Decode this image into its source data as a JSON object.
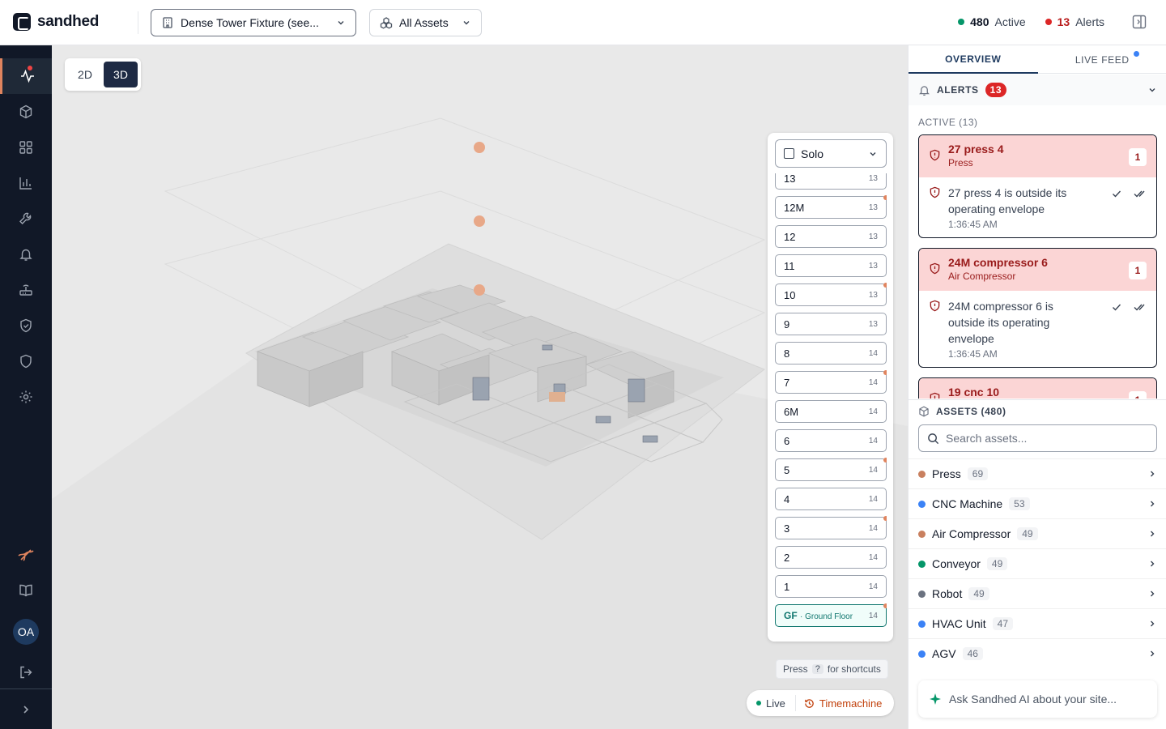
{
  "app": {
    "name": "sandhed"
  },
  "header": {
    "site_selector": "Dense Tower Fixture (see...",
    "asset_filter": "All Assets",
    "active_count": "480",
    "active_label": "Active",
    "alerts_count": "13",
    "alerts_label": "Alerts"
  },
  "sidebar": {
    "items": [
      {
        "name": "activity",
        "icon": "activity-icon",
        "active": true
      },
      {
        "name": "assets",
        "icon": "cube-icon"
      },
      {
        "name": "dashboard",
        "icon": "grid-icon"
      },
      {
        "name": "analytics",
        "icon": "bar-chart-icon"
      },
      {
        "name": "maintenance",
        "icon": "wrench-icon"
      },
      {
        "name": "alerts",
        "icon": "bell-icon"
      },
      {
        "name": "gateways",
        "icon": "router-icon"
      },
      {
        "name": "compliance",
        "icon": "shield-check-icon"
      },
      {
        "name": "security",
        "icon": "shield-icon"
      },
      {
        "name": "settings",
        "icon": "gear-icon"
      }
    ],
    "avatar_initials": "OA"
  },
  "viewport": {
    "view_modes": [
      "2D",
      "3D"
    ],
    "selected_view": "3D",
    "solo_label": "Solo",
    "floors": [
      {
        "name": "13",
        "count": "13",
        "alert": false
      },
      {
        "name": "12M",
        "count": "13",
        "alert": true
      },
      {
        "name": "12",
        "count": "13",
        "alert": false
      },
      {
        "name": "11",
        "count": "13",
        "alert": false
      },
      {
        "name": "10",
        "count": "13",
        "alert": true
      },
      {
        "name": "9",
        "count": "13",
        "alert": false
      },
      {
        "name": "8",
        "count": "14",
        "alert": false
      },
      {
        "name": "7",
        "count": "14",
        "alert": true
      },
      {
        "name": "6M",
        "count": "14",
        "alert": false
      },
      {
        "name": "6",
        "count": "14",
        "alert": false
      },
      {
        "name": "5",
        "count": "14",
        "alert": true
      },
      {
        "name": "4",
        "count": "14",
        "alert": false
      },
      {
        "name": "3",
        "count": "14",
        "alert": true
      },
      {
        "name": "2",
        "count": "14",
        "alert": false
      },
      {
        "name": "1",
        "count": "14",
        "alert": false
      }
    ],
    "ground_floor": {
      "code": "GF",
      "name": "· Ground Floor",
      "count": "14",
      "alert": true
    },
    "shortcuts": {
      "pre": "Press",
      "key": "?",
      "post": "for shortcuts"
    },
    "live_label": "Live",
    "timemachine_label": "Timemachine"
  },
  "right_panel": {
    "tabs": [
      "OVERVIEW",
      "LIVE FEED"
    ],
    "alerts_title": "ALERTS",
    "alerts_badge": "13",
    "active_label": "ACTIVE (13)",
    "alerts": [
      {
        "title": "27 press 4",
        "type": "Press",
        "count": "1",
        "message": "27 press 4 is outside its operating envelope",
        "time": "1:36:45 AM"
      },
      {
        "title": "24M compressor 6",
        "type": "Air Compressor",
        "count": "1",
        "message": "24M compressor 6 is outside its operating envelope",
        "time": "1:36:45 AM"
      },
      {
        "title": "19 cnc 10",
        "type": "",
        "count": "1",
        "message": "",
        "time": ""
      }
    ],
    "assets_title": "ASSETS (480)",
    "search_placeholder": "Search assets...",
    "categories": [
      {
        "name": "Press",
        "count": "69",
        "color": "#c9805f"
      },
      {
        "name": "CNC Machine",
        "count": "53",
        "color": "#3b82f6"
      },
      {
        "name": "Air Compressor",
        "count": "49",
        "color": "#c9805f"
      },
      {
        "name": "Conveyor",
        "count": "49",
        "color": "#059669"
      },
      {
        "name": "Robot",
        "count": "49",
        "color": "#6b7280"
      },
      {
        "name": "HVAC Unit",
        "count": "47",
        "color": "#3b82f6"
      },
      {
        "name": "AGV",
        "count": "46",
        "color": "#3b82f6"
      }
    ],
    "ai_prompt": "Ask Sandhed AI about your site..."
  },
  "colors": {
    "accent": "#e0845e",
    "alert": "#dc2626",
    "nav": "#111827",
    "live": "#059669"
  }
}
